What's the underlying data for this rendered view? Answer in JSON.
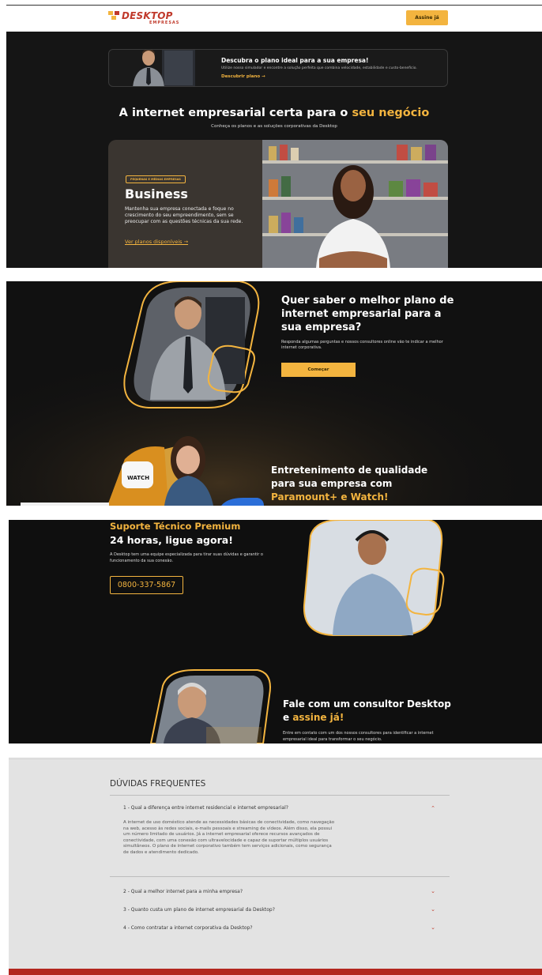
{
  "header": {
    "logo_main": "DESKTOP",
    "logo_sub": "EMPRESAS",
    "cta_label": "Assine já"
  },
  "promo": {
    "title": "Descubra o plano ideal para a sua empresa!",
    "description": "Utilize nosso simulador e encontre a solução perfeita que combina velocidade, estabilidade e custo-benefício.",
    "link": "Descubrir plano  →"
  },
  "hero": {
    "title_start": "A internet empresarial certa para o ",
    "title_highlight": "seu negócio",
    "subtitle": "Conheça os planos e as soluções corporativas da Desktop"
  },
  "business_card": {
    "tag": "PEQUENAS E MÉDIAS EMPRESAS",
    "title": "Business",
    "description": "Mantenha sua empresa conectada e foque no crescimento do seu empreendimento, sem se preocupar com as questões técnicas da sua rede.",
    "link": "Ver planos disponíveis  →"
  },
  "consult_section": {
    "title": "Quer saber o melhor plano de internet empresarial para a sua empresa?",
    "description": "Responda algumas perguntas e nossos consultores online vão te indicar a melhor internet corporativa.",
    "button": "Começar"
  },
  "entertainment": {
    "title_start": "Entretenimento de qualidade para sua empresa com ",
    "title_highlight": "Paramount+ e Watch!",
    "badge": "WATCH"
  },
  "support": {
    "title": "Suporte Técnico Premium",
    "subtitle": "24 horas, ligue agora!",
    "description": "A Desktop tem uma equipe especializada para tirar suas dúvidas e garantir o funcionamento da sua conexão.",
    "phone": "0800-337-5867"
  },
  "consultant": {
    "title_start": "Fale com um consultor Desktop e ",
    "title_highlight": "assine já!",
    "description": "Entre em contato com um dos nossos consultores para identificar a internet empresarial ideal para transformar o seu negócio."
  },
  "faq": {
    "heading": "DÚVIDAS FREQUENTES",
    "items": [
      {
        "question": "1 - Qual a diferença entre internet residencial e internet empresarial?",
        "answer": "A internet de uso doméstico atende as necessidades básicas de conectividade, como navegação na web, acesso às redes sociais, e-mails pessoais e streaming de vídeos. Além disso, ela possui um número limitado de usuários. Já a internet empresarial oferece recursos avançados de conectividade, com uma conexão com ultravelocidade e capaz de suportar múltiplos usuários simultâneos. O plano de internet corporativo também tem serviços adicionais, como segurança de dados e atendimento dedicado."
      },
      {
        "question": "2 - Qual a melhor internet para a minha empresa?"
      },
      {
        "question": "3 - Quanto custa um plano de internet empresarial da Desktop?"
      },
      {
        "question": "4 - Como contratar a internet corporativa da Desktop?"
      }
    ]
  },
  "colors": {
    "accent": "#f3b43f",
    "brand_red": "#c0392b",
    "dark_bg": "#151515"
  }
}
